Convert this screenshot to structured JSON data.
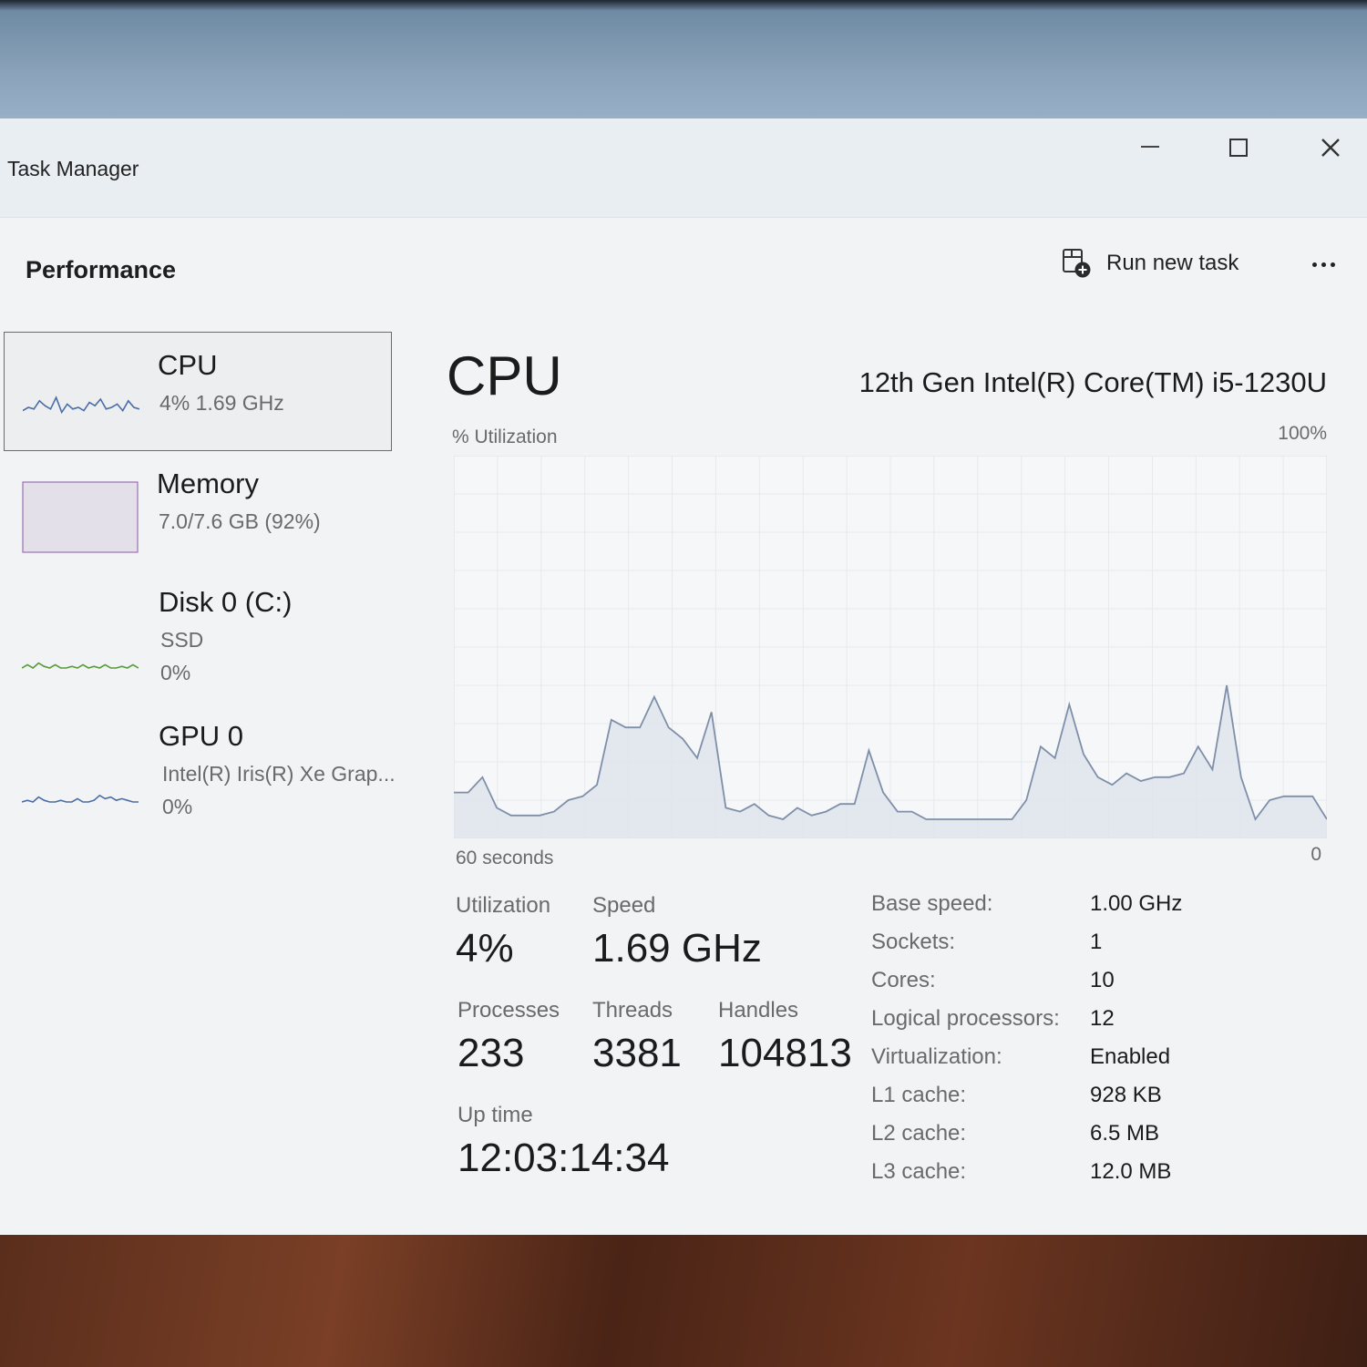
{
  "window": {
    "title": "Task Manager"
  },
  "header": {
    "title": "Performance",
    "run_task_label": "Run new task"
  },
  "sidebar": {
    "items": [
      {
        "name": "CPU",
        "sub": "4%  1.69 GHz"
      },
      {
        "name": "Memory",
        "sub": "7.0/7.6 GB (92%)"
      },
      {
        "name": "Disk 0 (C:)",
        "sub": "SSD",
        "sub2": "0%"
      },
      {
        "name": "GPU 0",
        "sub": "Intel(R) Iris(R) Xe Grap...",
        "sub2": "0%"
      }
    ]
  },
  "main": {
    "title": "CPU",
    "model": "12th Gen Intel(R) Core(TM) i5-1230U",
    "util_label": "% Utilization",
    "max_label": "100%",
    "time_label": "60 seconds",
    "zero_label": "0"
  },
  "chart_data": {
    "type": "area",
    "ylim": [
      0,
      100
    ],
    "x_range_seconds": 60,
    "values": [
      12,
      12,
      16,
      8,
      6,
      6,
      6,
      7,
      10,
      11,
      14,
      31,
      29,
      29,
      37,
      29,
      26,
      21,
      33,
      8,
      7,
      9,
      6,
      5,
      8,
      6,
      7,
      9,
      9,
      23,
      12,
      7,
      7,
      5,
      5,
      5,
      5,
      5,
      5,
      5,
      10,
      24,
      21,
      35,
      22,
      16,
      14,
      17,
      15,
      16,
      16,
      17,
      24,
      18,
      40,
      16,
      5,
      10,
      11,
      11,
      11,
      5
    ],
    "grid": true,
    "colors": {
      "line": "#7f8fa9",
      "fill": "#dfe4ec",
      "grid": "#e6e9ee"
    }
  },
  "stats": {
    "utilization": {
      "label": "Utilization",
      "value": "4%"
    },
    "speed": {
      "label": "Speed",
      "value": "1.69 GHz"
    },
    "processes": {
      "label": "Processes",
      "value": "233"
    },
    "threads": {
      "label": "Threads",
      "value": "3381"
    },
    "handles": {
      "label": "Handles",
      "value": "104813"
    },
    "uptime": {
      "label": "Up time",
      "value": "12:03:14:34"
    }
  },
  "specs": [
    {
      "label": "Base speed:",
      "value": "1.00 GHz"
    },
    {
      "label": "Sockets:",
      "value": "1"
    },
    {
      "label": "Cores:",
      "value": "10"
    },
    {
      "label": "Logical processors:",
      "value": "12"
    },
    {
      "label": "Virtualization:",
      "value": "Enabled"
    },
    {
      "label": "L1 cache:",
      "value": "928 KB"
    },
    {
      "label": "L2 cache:",
      "value": "6.5 MB"
    },
    {
      "label": "L3 cache:",
      "value": "12.0 MB"
    }
  ],
  "thumbs": {
    "cpu": [
      8,
      10,
      9,
      14,
      11,
      9,
      16,
      7,
      12,
      9,
      10,
      8,
      13,
      11,
      15,
      9,
      10,
      12,
      8,
      14,
      10,
      9
    ],
    "disk": [
      0,
      2,
      0,
      3,
      1,
      0,
      2,
      0,
      0,
      1,
      0,
      2,
      0,
      1,
      0,
      2,
      0,
      0,
      1,
      0,
      2,
      0
    ],
    "gpu": [
      0,
      1,
      0,
      3,
      1,
      0,
      0,
      1,
      0,
      0,
      2,
      0,
      0,
      1,
      4,
      2,
      3,
      1,
      2,
      1,
      0,
      0
    ],
    "colors": {
      "cpu": "#4a6da7",
      "memory_border": "#9c6fb0",
      "memory_fill": "#e4e0ea",
      "disk": "#5a9a3a",
      "gpu": "#4a6da7"
    }
  }
}
